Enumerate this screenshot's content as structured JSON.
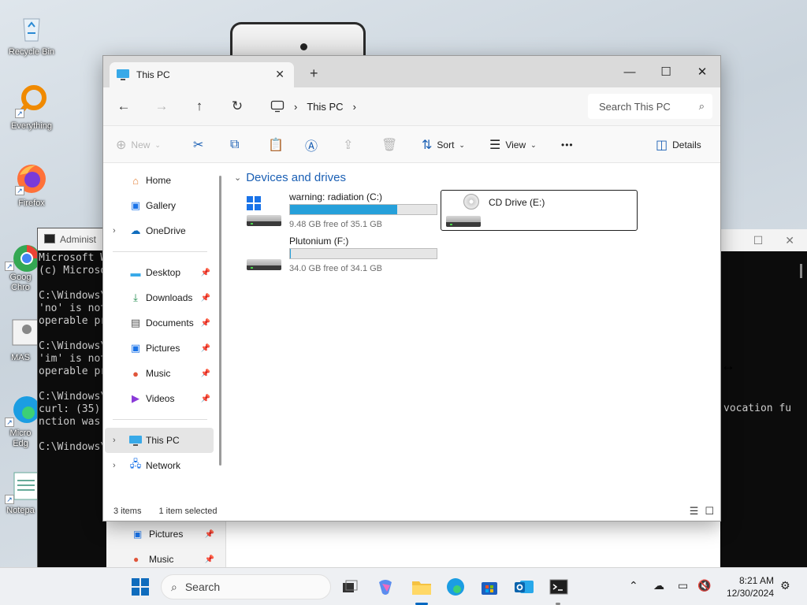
{
  "desktop": {
    "icons": [
      {
        "label": "Recycle Bin",
        "icon": "recycle-bin-icon"
      },
      {
        "label": "Everything",
        "icon": "everything-icon"
      },
      {
        "label": "Firefox",
        "icon": "firefox-icon"
      },
      {
        "label": "Goog Chro",
        "icon": "chrome-icon"
      },
      {
        "label": "MAS",
        "icon": "mas-icon"
      },
      {
        "label": "Micro Edg",
        "icon": "edge-icon"
      },
      {
        "label": "Notepa",
        "icon": "notepad-icon"
      }
    ]
  },
  "cmd": {
    "title": "Administ",
    "lines": [
      "Microsoft W",
      "(c) Microso",
      "",
      "C:\\Windows\\",
      "'no' is not",
      "operable pr",
      "",
      "C:\\Windows\\",
      "'im' is not",
      "operable pr",
      "",
      "C:\\Windows\\",
      "curl: (35)",
      "nction was",
      "",
      "C:\\Windows\\"
    ],
    "right_text": "vocation fu"
  },
  "behind_sidebar": [
    {
      "label": "Pictures"
    },
    {
      "label": "Music"
    }
  ],
  "explorer": {
    "tab_title": "This PC",
    "new_tab": "+",
    "address": "This PC",
    "search_placeholder": "Search This PC",
    "toolbar": {
      "new": "New",
      "sort": "Sort",
      "view": "View",
      "more": "•••",
      "details": "Details"
    },
    "sidebar": {
      "home": "Home",
      "gallery": "Gallery",
      "onedrive": "OneDrive",
      "desktop": "Desktop",
      "downloads": "Downloads",
      "documents": "Documents",
      "pictures": "Pictures",
      "music": "Music",
      "videos": "Videos",
      "thispc": "This PC",
      "network": "Network"
    },
    "group_header": "Devices and drives",
    "drives": [
      {
        "name": "warning: radiation (C:)",
        "free_text": "9.48 GB free of 35.1 GB",
        "used_fraction": 0.73
      },
      {
        "name": "CD Drive (E:)"
      },
      {
        "name": "Plutonium (F:)",
        "free_text": "34.0 GB free of 34.1 GB",
        "used_fraction": 0.003
      }
    ],
    "status": {
      "items": "3 items",
      "selected": "1 item selected"
    }
  },
  "taskbar": {
    "search_label": "Search",
    "time": "8:21 AM",
    "date": "12/30/2024"
  },
  "colors": {
    "accent": "#0067c0",
    "drive_bar": "#26a0da",
    "group_header": "#1a5fb4"
  }
}
